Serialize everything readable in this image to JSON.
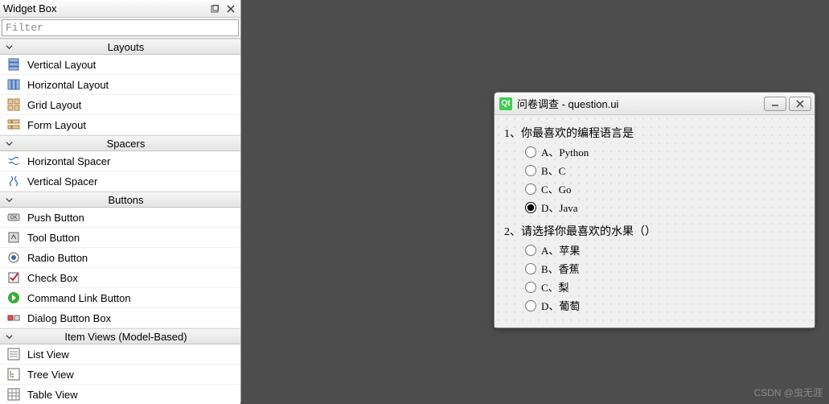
{
  "widgetBox": {
    "title": "Widget Box",
    "filterPlaceholder": "Filter",
    "categories": [
      {
        "label": "Layouts",
        "items": [
          {
            "name": "Vertical Layout"
          },
          {
            "name": "Horizontal Layout"
          },
          {
            "name": "Grid Layout"
          },
          {
            "name": "Form Layout"
          }
        ]
      },
      {
        "label": "Spacers",
        "items": [
          {
            "name": "Horizontal Spacer"
          },
          {
            "name": "Vertical Spacer"
          }
        ]
      },
      {
        "label": "Buttons",
        "items": [
          {
            "name": "Push Button"
          },
          {
            "name": "Tool Button"
          },
          {
            "name": "Radio Button"
          },
          {
            "name": "Check Box"
          },
          {
            "name": "Command Link Button"
          },
          {
            "name": "Dialog Button Box"
          }
        ]
      },
      {
        "label": "Item Views (Model-Based)",
        "items": [
          {
            "name": "List View"
          },
          {
            "name": "Tree View"
          },
          {
            "name": "Table View"
          }
        ]
      }
    ]
  },
  "formWindow": {
    "title": "问卷调查 - question.ui",
    "q1": {
      "label": "1、你最喜欢的编程语言是",
      "options": [
        {
          "label": "A、Python",
          "checked": false
        },
        {
          "label": "B、C",
          "checked": false
        },
        {
          "label": "C、Go",
          "checked": false
        },
        {
          "label": "D、Java",
          "checked": true
        }
      ]
    },
    "q2": {
      "label": "2、请选择你最喜欢的水果（）",
      "options": [
        {
          "label": "A、苹果",
          "checked": false
        },
        {
          "label": "B、香蕉",
          "checked": false
        },
        {
          "label": "C、梨",
          "checked": false
        },
        {
          "label": "D、葡萄",
          "checked": false
        }
      ]
    }
  },
  "watermark": "CSDN @虫无涯"
}
